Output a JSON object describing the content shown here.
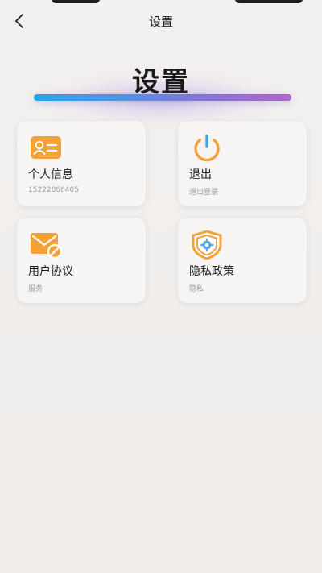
{
  "nav": {
    "title": "设置"
  },
  "hero": {
    "title": "设置"
  },
  "cards": [
    {
      "key": "profile",
      "label": "个人信息",
      "sub": "15222866405",
      "icon": "id-card-icon"
    },
    {
      "key": "logout",
      "label": "退出",
      "sub": "退出登录",
      "icon": "power-icon"
    },
    {
      "key": "agreement",
      "label": "用户协议",
      "sub": "服务",
      "icon": "agreement-envelope-icon"
    },
    {
      "key": "privacy",
      "label": "隐私政策",
      "sub": "隐私",
      "icon": "shield-gear-icon"
    }
  ],
  "colors": {
    "accent_orange": "#f3a23b",
    "bar_start": "#24a6ee",
    "bar_end": "#b067c5",
    "background": "#f1eeec"
  }
}
